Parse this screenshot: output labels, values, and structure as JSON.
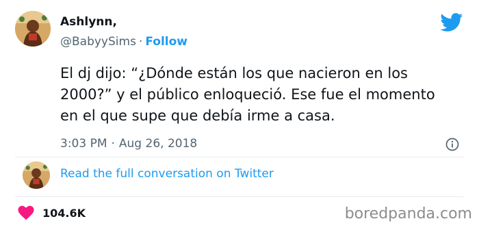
{
  "author": {
    "name": "Ashlynn,",
    "handle": "@BabyySims",
    "separator": "·",
    "follow_label": "Follow",
    "avatar_icon": "avatar-illustration"
  },
  "tweet": {
    "text": "El dj dijo: “¿Dónde están los que nacieron en los 2000?” y el público enloqueció. Ese fue el momento en el que supe que debía irme a casa.",
    "time": "3:03 PM",
    "date_separator": "·",
    "date": "Aug 26, 2018"
  },
  "conversation": {
    "link_label": "Read the full conversation on Twitter"
  },
  "engagement": {
    "likes": "104.6K"
  },
  "watermark": "boredpanda.com",
  "icons": {
    "brand": "twitter-bird-icon",
    "info": "info-icon",
    "like": "heart-icon"
  },
  "colors": {
    "accent": "#1d9bf0",
    "heart": "#f91880",
    "text": "#0f1419",
    "muted": "#536471"
  }
}
